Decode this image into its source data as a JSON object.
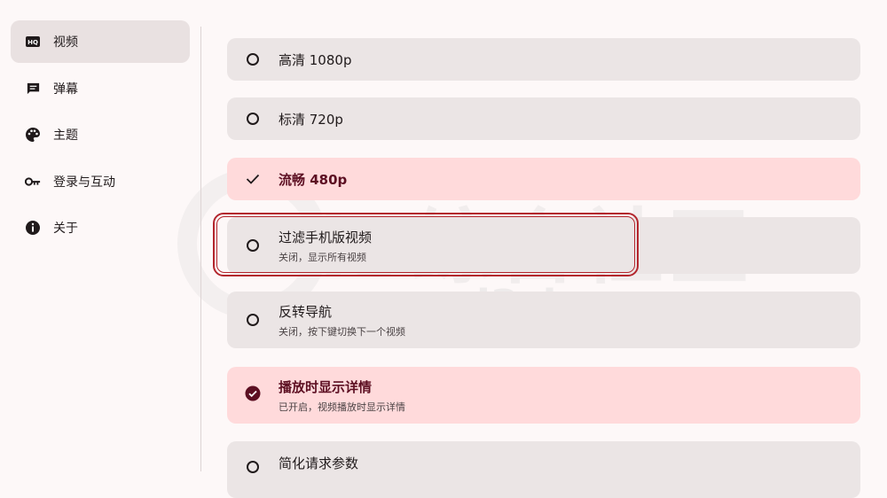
{
  "sidebar": {
    "items": [
      {
        "label": "视频",
        "icon": "hq-icon",
        "active": true
      },
      {
        "label": "弹幕",
        "icon": "comment-icon"
      },
      {
        "label": "主题",
        "icon": "palette-icon"
      },
      {
        "label": "登录与互动",
        "icon": "key-icon"
      },
      {
        "label": "关于",
        "icon": "info-icon"
      }
    ]
  },
  "settings": {
    "items": [
      {
        "title": "高清 1080p",
        "control": "radio"
      },
      {
        "title": "标清 720p",
        "control": "radio"
      },
      {
        "title": "流畅 480p",
        "control": "check",
        "selected": true
      },
      {
        "title": "过滤手机版视频",
        "subtitle": "关闭，显示所有视频",
        "control": "radio",
        "focused": true
      },
      {
        "title": "反转导航",
        "subtitle": "关闭，按下键切换下一个视频",
        "control": "radio"
      },
      {
        "title": "播放时显示详情",
        "subtitle": "已开启，视频播放时显示详情",
        "control": "check-circle",
        "selected": true
      },
      {
        "title": "简化请求参数",
        "control": "radio"
      }
    ]
  },
  "watermark": {
    "text": "i3综合社区",
    "url": "www.i3zh.com"
  },
  "colors": {
    "accent": "#5c0f22",
    "selected_bg": "#ffdadb",
    "card_bg": "#ebe5e5",
    "focus": "#b3262d"
  }
}
